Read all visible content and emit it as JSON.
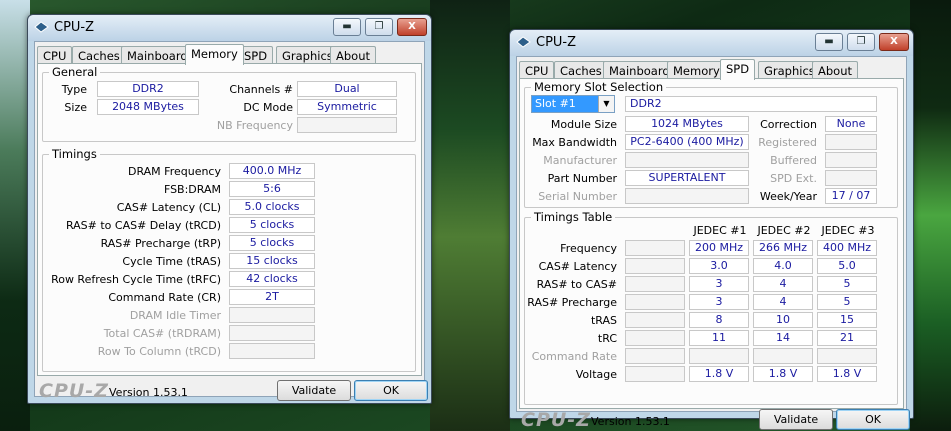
{
  "left": {
    "title": "CPU-Z",
    "tabs": [
      "CPU",
      "Caches",
      "Mainboard",
      "Memory",
      "SPD",
      "Graphics",
      "About"
    ],
    "active_tab": "Memory",
    "general": {
      "title": "General",
      "type_label": "Type",
      "type_value": "DDR2",
      "size_label": "Size",
      "size_value": "2048 MBytes",
      "channels_label": "Channels #",
      "channels_value": "Dual",
      "dcmode_label": "DC Mode",
      "dcmode_value": "Symmetric",
      "nbfreq_label": "NB Frequency",
      "nbfreq_value": ""
    },
    "timings": {
      "title": "Timings",
      "rows": [
        {
          "label": "DRAM Frequency",
          "value": "400.0 MHz",
          "enabled": true
        },
        {
          "label": "FSB:DRAM",
          "value": "5:6",
          "enabled": true
        },
        {
          "label": "CAS# Latency (CL)",
          "value": "5.0 clocks",
          "enabled": true
        },
        {
          "label": "RAS# to CAS# Delay (tRCD)",
          "value": "5 clocks",
          "enabled": true
        },
        {
          "label": "RAS# Precharge (tRP)",
          "value": "5 clocks",
          "enabled": true
        },
        {
          "label": "Cycle Time (tRAS)",
          "value": "15 clocks",
          "enabled": true
        },
        {
          "label": "Row Refresh Cycle Time (tRFC)",
          "value": "42 clocks",
          "enabled": true
        },
        {
          "label": "Command Rate (CR)",
          "value": "2T",
          "enabled": true
        },
        {
          "label": "DRAM Idle Timer",
          "value": "",
          "enabled": false
        },
        {
          "label": "Total CAS# (tRDRAM)",
          "value": "",
          "enabled": false
        },
        {
          "label": "Row To Column (tRCD)",
          "value": "",
          "enabled": false
        }
      ]
    },
    "footer": {
      "logo": "CPU-Z",
      "version": "Version 1.53.1",
      "validate": "Validate",
      "ok": "OK"
    }
  },
  "right": {
    "title": "CPU-Z",
    "tabs": [
      "CPU",
      "Caches",
      "Mainboard",
      "Memory",
      "SPD",
      "Graphics",
      "About"
    ],
    "active_tab": "SPD",
    "slot_group": {
      "title": "Memory Slot Selection",
      "slot_selected": "Slot #1",
      "mem_type": "DDR2",
      "module_size_label": "Module Size",
      "module_size": "1024 MBytes",
      "max_bw_label": "Max Bandwidth",
      "max_bw": "PC2-6400 (400 MHz)",
      "manufacturer_label": "Manufacturer",
      "manufacturer": "",
      "part_label": "Part Number",
      "part": "SUPERTALENT",
      "serial_label": "Serial Number",
      "serial": "",
      "correction_label": "Correction",
      "correction": "None",
      "registered_label": "Registered",
      "registered": "",
      "buffered_label": "Buffered",
      "buffered": "",
      "spdext_label": "SPD Ext.",
      "spdext": "",
      "weekyear_label": "Week/Year",
      "weekyear": "17 / 07"
    },
    "timings_table": {
      "title": "Timings Table",
      "headers": [
        "JEDEC #1",
        "JEDEC #2",
        "JEDEC #3"
      ],
      "rows": [
        {
          "label": "Frequency",
          "enabled": true,
          "values": [
            "200 MHz",
            "266 MHz",
            "400 MHz"
          ]
        },
        {
          "label": "CAS# Latency",
          "enabled": true,
          "values": [
            "3.0",
            "4.0",
            "5.0"
          ]
        },
        {
          "label": "RAS# to CAS#",
          "enabled": true,
          "values": [
            "3",
            "4",
            "5"
          ]
        },
        {
          "label": "RAS# Precharge",
          "enabled": true,
          "values": [
            "3",
            "4",
            "5"
          ]
        },
        {
          "label": "tRAS",
          "enabled": true,
          "values": [
            "8",
            "10",
            "15"
          ]
        },
        {
          "label": "tRC",
          "enabled": true,
          "values": [
            "11",
            "14",
            "21"
          ]
        },
        {
          "label": "Command Rate",
          "enabled": false,
          "values": [
            "",
            "",
            ""
          ]
        },
        {
          "label": "Voltage",
          "enabled": true,
          "values": [
            "1.8 V",
            "1.8 V",
            "1.8 V"
          ]
        }
      ]
    },
    "footer": {
      "logo": "CPU-Z",
      "version": "Version 1.53.1",
      "validate": "Validate",
      "ok": "OK"
    }
  },
  "window_buttons": {
    "minimize": "▬",
    "maximize": "❐",
    "close": "X"
  }
}
